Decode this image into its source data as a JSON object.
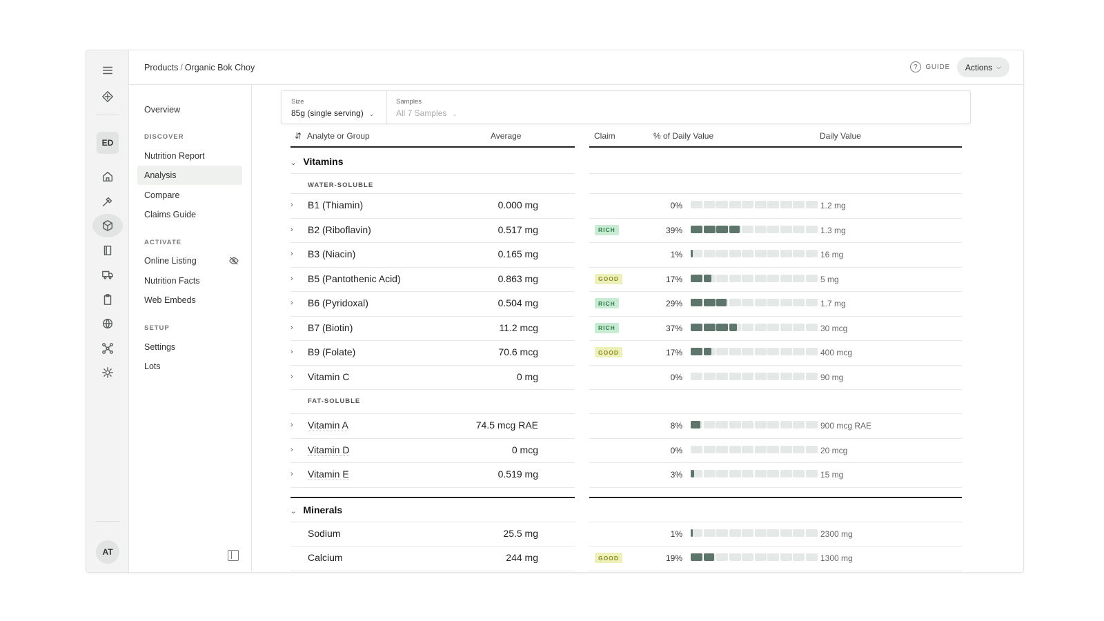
{
  "breadcrumb": {
    "parent": "Products",
    "separator": "/",
    "current": "Organic Bok Choy"
  },
  "header": {
    "guide_label": "GUIDE",
    "actions_label": "Actions"
  },
  "rail": {
    "workspace_badge": "ED",
    "user_avatar": "AT",
    "icons": [
      "menu-icon",
      "logo-icon",
      "home-icon",
      "tool-icon",
      "cube-icon",
      "book-icon",
      "truck-icon",
      "clipboard-icon",
      "globe-icon",
      "network-icon",
      "gear-icon"
    ]
  },
  "nav": {
    "overview": "Overview",
    "sections": [
      {
        "title": "DISCOVER",
        "items": [
          "Nutrition Report",
          "Analysis",
          "Compare",
          "Claims Guide"
        ]
      },
      {
        "title": "ACTIVATE",
        "items": [
          "Online Listing",
          "Nutrition Facts",
          "Web Embeds"
        ]
      },
      {
        "title": "SETUP",
        "items": [
          "Settings",
          "Lots"
        ]
      }
    ],
    "active_item": "Analysis"
  },
  "filters": {
    "size": {
      "label": "Size",
      "value": "85g (single serving)"
    },
    "samples": {
      "label": "Samples",
      "value": "All 7 Samples"
    }
  },
  "table": {
    "columns": {
      "analyte": "Analyte or Group",
      "average": "Average",
      "claim": "Claim",
      "pdv": "% of Daily Value",
      "dv": "Daily Value"
    },
    "groups": [
      {
        "name": "Vitamins",
        "subgroups": [
          {
            "name": "WATER-SOLUBLE",
            "rows": [
              {
                "name": "B1 (Thiamin)",
                "average": "0.000 mg",
                "claim": "",
                "pct_label": "0%",
                "pct": 0,
                "dv": "1.2 mg"
              },
              {
                "name": "B2 (Riboflavin)",
                "average": "0.517 mg",
                "claim": "RICH",
                "pct_label": "39%",
                "pct": 39,
                "dv": "1.3 mg"
              },
              {
                "name": "B3 (Niacin)",
                "average": "0.165 mg",
                "claim": "",
                "pct_label": "1%",
                "pct": 1,
                "dv": "16 mg"
              },
              {
                "name": "B5 (Pantothenic Acid)",
                "average": "0.863 mg",
                "claim": "GOOD",
                "pct_label": "17%",
                "pct": 17,
                "dv": "5 mg"
              },
              {
                "name": "B6 (Pyridoxal)",
                "average": "0.504 mg",
                "claim": "RICH",
                "pct_label": "29%",
                "pct": 29,
                "dv": "1.7 mg"
              },
              {
                "name": "B7 (Biotin)",
                "average": "11.2 mcg",
                "claim": "RICH",
                "pct_label": "37%",
                "pct": 37,
                "dv": "30 mcg"
              },
              {
                "name": "B9 (Folate)",
                "average": "70.6 mcg",
                "claim": "GOOD",
                "pct_label": "17%",
                "pct": 17,
                "dv": "400 mcg"
              },
              {
                "name": "Vitamin C",
                "average": "0 mg",
                "claim": "",
                "pct_label": "0%",
                "pct": 0,
                "dv": "90 mg"
              }
            ]
          },
          {
            "name": "FAT-SOLUBLE",
            "rows": [
              {
                "name": "Vitamin A",
                "average": "74.5 mcg RAE",
                "claim": "",
                "pct_label": "8%",
                "pct": 8,
                "dv": "900 mcg RAE"
              },
              {
                "name": "Vitamin D",
                "average": "0 mcg",
                "claim": "",
                "pct_label": "0%",
                "pct": 0,
                "dv": "20 mcg"
              },
              {
                "name": "Vitamin E",
                "average": "0.519 mg",
                "claim": "",
                "pct_label": "3%",
                "pct": 3,
                "dv": "15 mg"
              }
            ]
          }
        ]
      },
      {
        "name": "Minerals",
        "rows": [
          {
            "name": "Sodium",
            "average": "25.5 mg",
            "claim": "",
            "pct_label": "1%",
            "pct": 1,
            "dv": "2300 mg"
          },
          {
            "name": "Calcium",
            "average": "244 mg",
            "claim": "GOOD",
            "pct_label": "19%",
            "pct": 19,
            "dv": "1300 mg"
          }
        ]
      }
    ]
  },
  "colors": {
    "bar_fill": "#5d756b",
    "bar_track": "#e4e8e6",
    "rich_bg": "#c7ecd3",
    "good_bg": "#eef0b9"
  }
}
